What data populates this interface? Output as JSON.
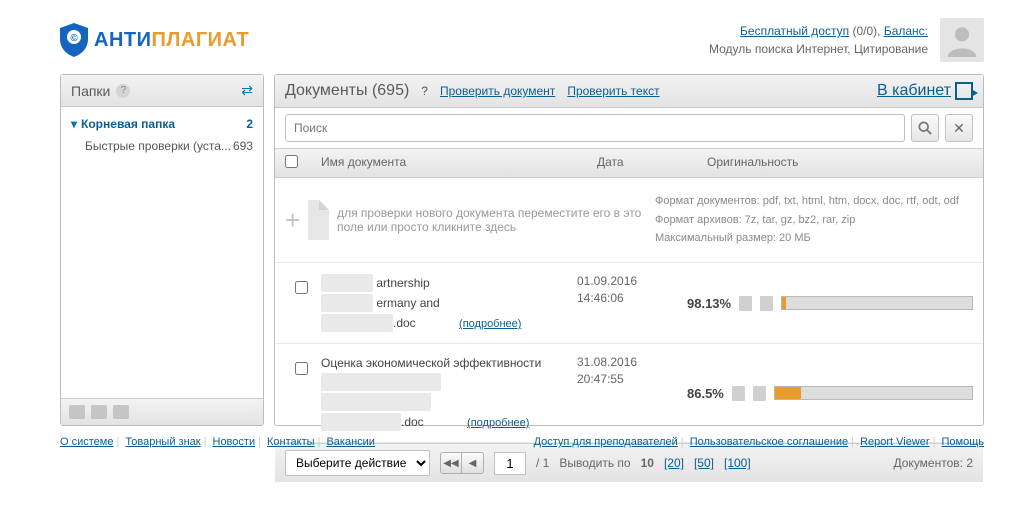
{
  "brand": {
    "anti": "АНТИ",
    "plag": "ПЛАГИАТ"
  },
  "header": {
    "free_access": "Бесплатный доступ",
    "free_count": "(0/0)",
    "balance": "Баланс:",
    "modules": "Модуль поиска Интернет, Цитирование"
  },
  "sidebar": {
    "title": "Папки",
    "root": {
      "label": "Корневая папка",
      "badge": "2"
    },
    "child": {
      "label": "Быстрые проверки (уста...",
      "badge": "693"
    }
  },
  "content": {
    "title_label": "Документы",
    "title_count": "(695)",
    "check_doc": "Проверить документ",
    "check_text": "Проверить текст",
    "cabinet": "В кабинет",
    "search_placeholder": "Поиск",
    "cols": {
      "name": "Имя документа",
      "date": "Дата",
      "orig": "Оригинальность"
    },
    "upload": {
      "hint": "для проверки нового документа переместите его в это поле или просто кликните здесь",
      "fmt_docs": "Формат документов: pdf, txt, html, htm, docx, doc, rtf, odt, odf",
      "fmt_arc": "Формат архивов: 7z, tar, gz, bz2, rar, zip",
      "maxsize": "Максимальный размер: 20 МБ"
    },
    "rows": [
      {
        "name_parts": [
          "artnership",
          "ermany and",
          ".doc"
        ],
        "details": "(подробнее)",
        "date": "01.09.2016",
        "time": "14:46:06",
        "pct": "98.13%",
        "fill": 1.9
      },
      {
        "name_clear": "Оценка экономической эффективности",
        "name_parts": [
          ".doc"
        ],
        "details": "(подробнее)",
        "date": "31.08.2016",
        "time": "20:47:55",
        "pct": "86.5%",
        "fill": 13.5
      }
    ],
    "footer": {
      "action": "Выберите действие",
      "page": "1",
      "total": "/ 1",
      "per_label": "Выводить по",
      "per_active": "10",
      "per_opts": [
        "[20]",
        "[50]",
        "[100]"
      ],
      "doc_count": "Документов: 2"
    }
  },
  "footer": {
    "left": [
      "О системе",
      "Товарный знак",
      "Новости",
      "Контакты",
      "Вакансии"
    ],
    "right": [
      "Доступ для преподавателей",
      "Пользовательское соглашение",
      "Report Viewer",
      "Помощь"
    ]
  }
}
